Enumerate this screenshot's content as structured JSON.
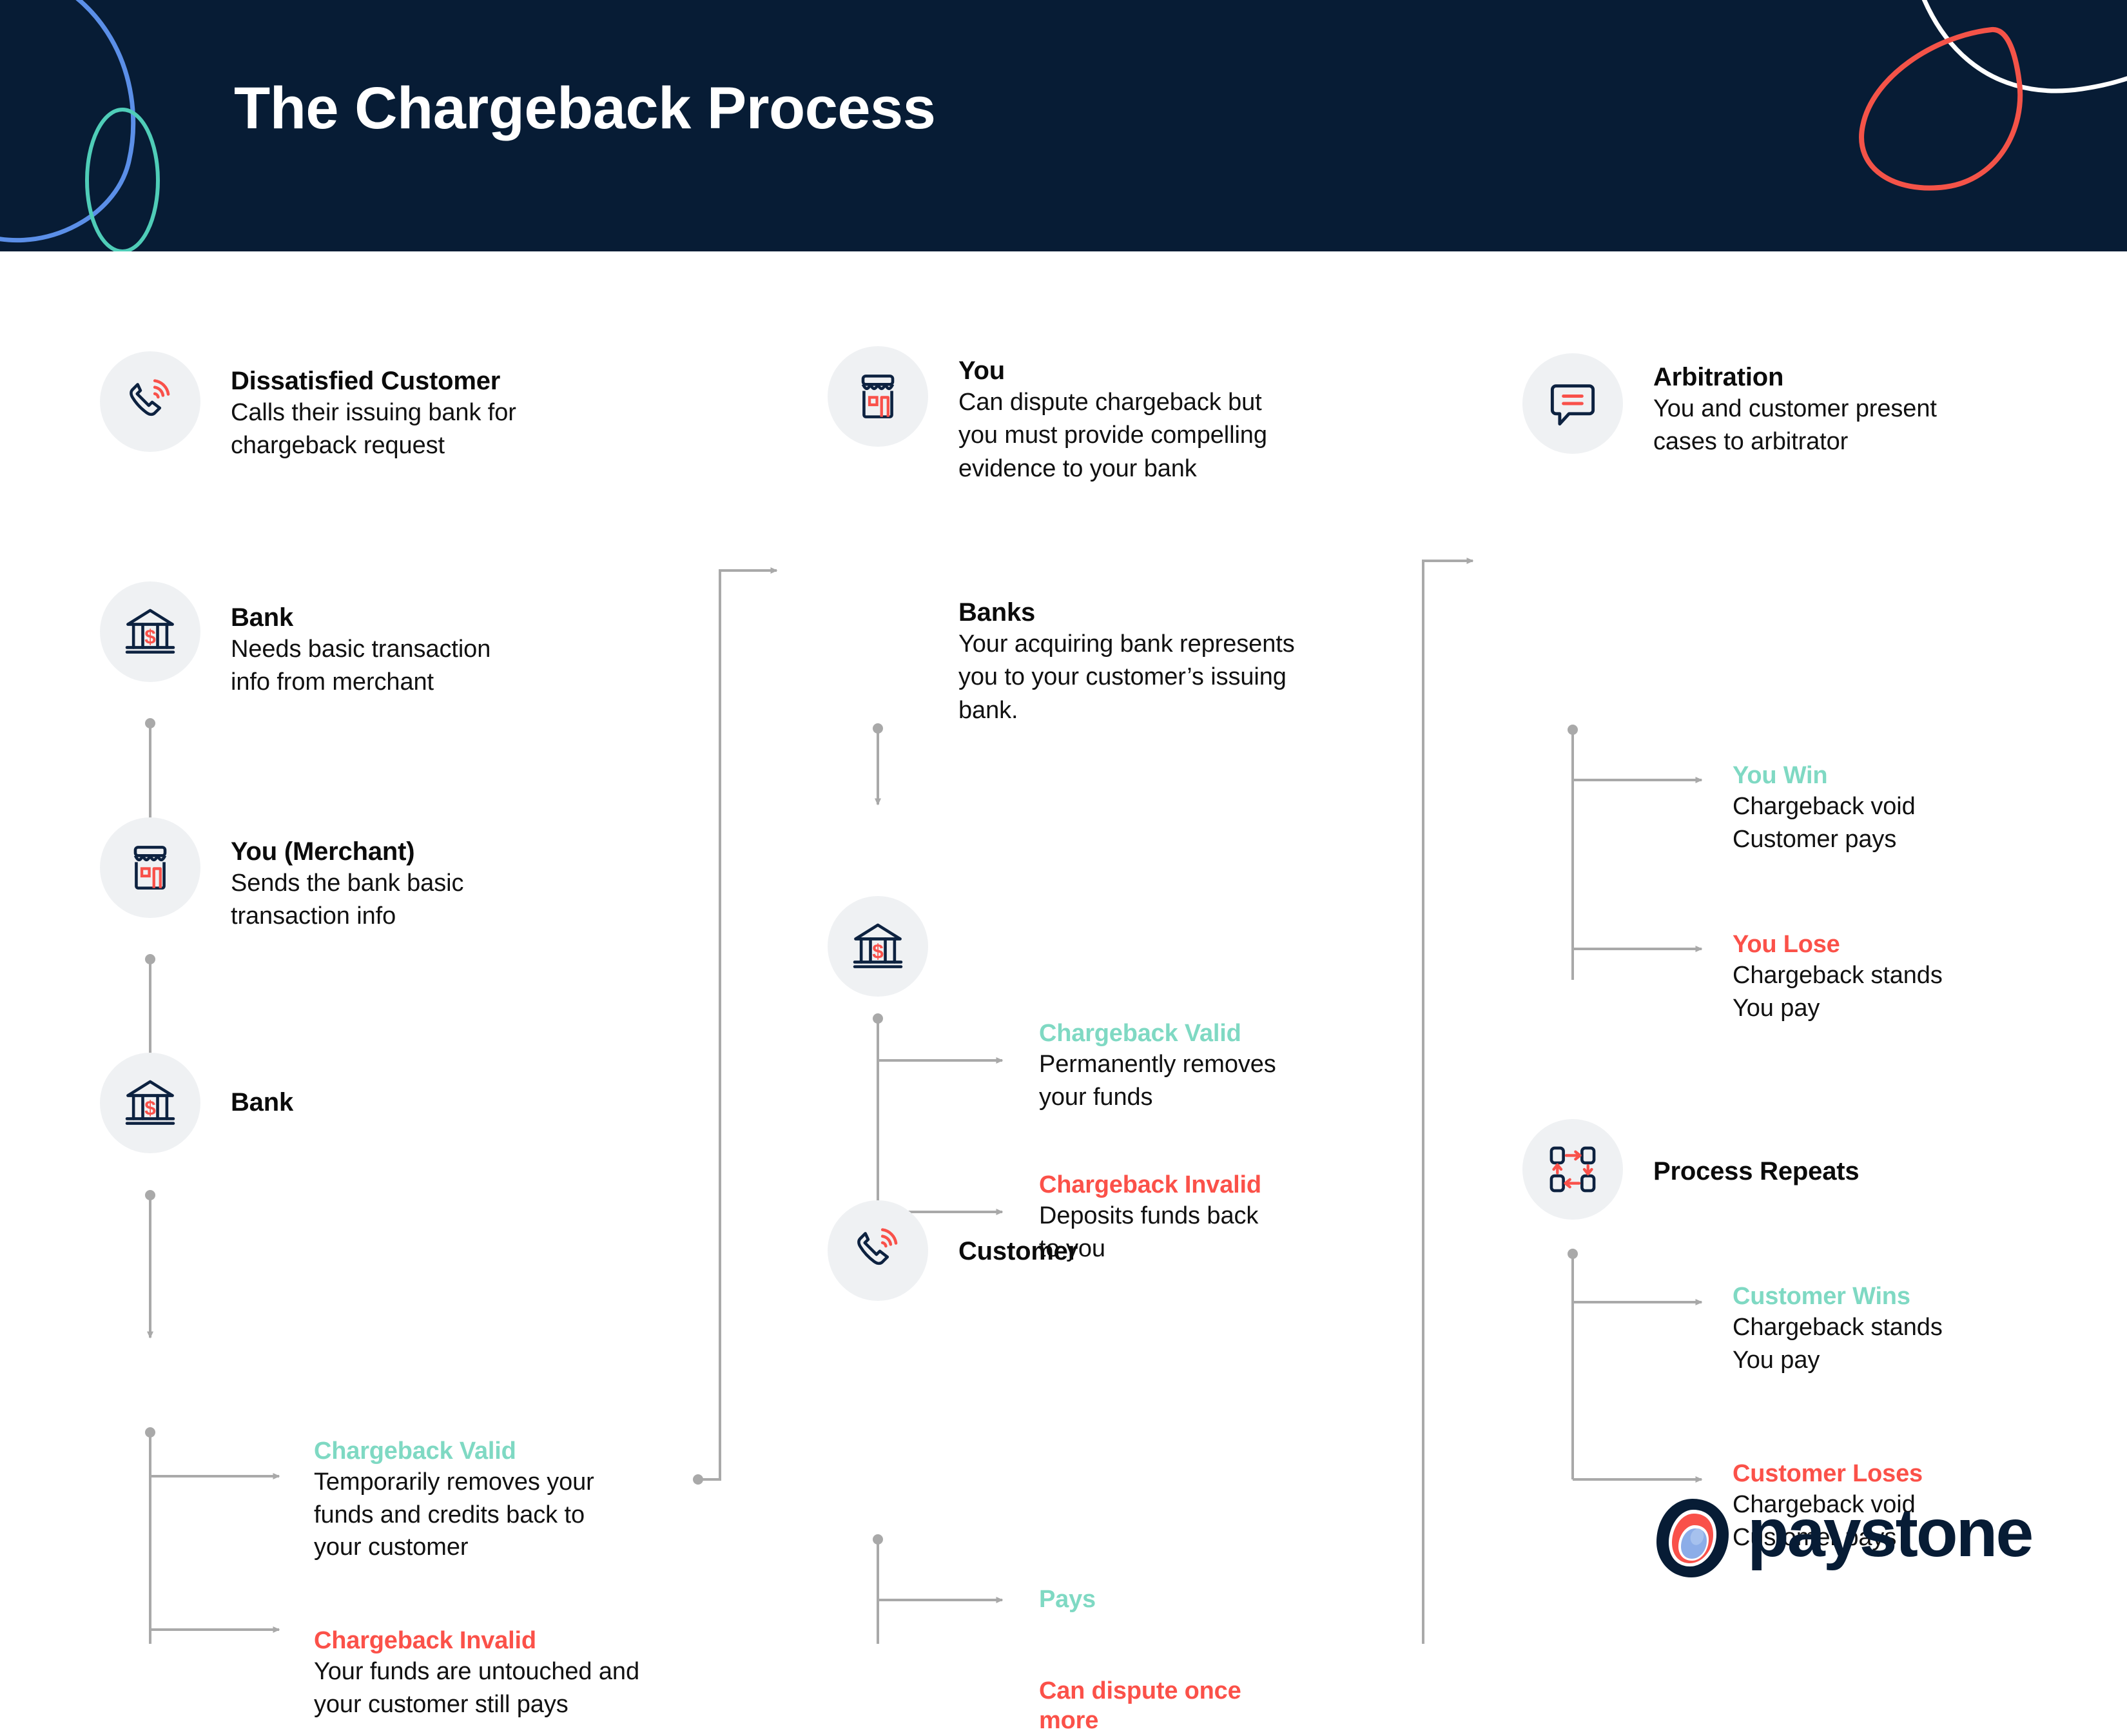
{
  "header": {
    "title": "The Chargeback Process",
    "bg_color": "#071C35",
    "decor": [
      {
        "name": "blue-blob-outline",
        "color": "#5B8FE8"
      },
      {
        "name": "teal-ellipse-outline",
        "color": "#4FCDB8"
      },
      {
        "name": "white-curve",
        "color": "#FFFFFF"
      },
      {
        "name": "coral-loop",
        "color": "#F45348"
      }
    ]
  },
  "colors": {
    "navy": "#071C35",
    "teal": "#7FD9C3",
    "coral": "#FB5149",
    "body_text": "#111111",
    "icon_bg": "#EFF1F3",
    "wire": "#A9A9A9"
  },
  "columns": [
    {
      "name": "column-1",
      "nodes": [
        {
          "icon": "phone-ringing-icon",
          "title": "Dissatisfied Customer",
          "desc": "Calls their issuing bank for\nchargeback request"
        },
        {
          "icon": "bank-dollar-icon",
          "title": "Bank",
          "desc": "Needs basic transaction\ninfo from merchant"
        },
        {
          "icon": "storefront-icon",
          "title": "You (Merchant)",
          "desc": "Sends the bank basic\ntransaction info"
        },
        {
          "icon": "bank-dollar-icon",
          "title": "Bank",
          "desc": ""
        }
      ],
      "outcomes": [
        {
          "kind": "valid",
          "title": "Chargeback Valid",
          "desc": "Temporarily removes your\nfunds and credits back to\nyour customer"
        },
        {
          "kind": "invalid",
          "title": "Chargeback Invalid",
          "desc": "Your funds are untouched and\nyour customer still pays"
        }
      ]
    },
    {
      "name": "column-2",
      "nodes": [
        {
          "icon": "storefront-icon",
          "title": "You",
          "desc": "Can dispute chargeback but\nyou must provide compelling\nevidence to your bank"
        },
        {
          "icon": "bank-dollar-icon",
          "title": "Banks",
          "desc": "Your acquiring bank represents\nyou to your customer’s issuing\nbank."
        },
        {
          "icon": "phone-ringing-icon",
          "title": "Customer",
          "desc": ""
        }
      ],
      "outcomes": [
        {
          "kind": "valid",
          "title": "Chargeback Valid",
          "desc": "Permanently removes\nyour funds"
        },
        {
          "kind": "invalid",
          "title": "Chargeback Invalid",
          "desc": "Deposits funds back\nto you"
        },
        {
          "kind": "valid",
          "title": "Pays",
          "desc": ""
        },
        {
          "kind": "invalid",
          "title": "Can dispute once\nmore",
          "desc": ""
        }
      ]
    },
    {
      "name": "column-3",
      "nodes": [
        {
          "icon": "speech-bubble-icon",
          "title": "Arbitration",
          "desc": "You and customer present\ncases to arbitrator"
        },
        {
          "icon": "process-repeat-icon",
          "title": "Process Repeats",
          "desc": ""
        }
      ],
      "outcomes": [
        {
          "kind": "valid",
          "title": "You Win",
          "desc": "Chargeback void\nCustomer pays"
        },
        {
          "kind": "invalid",
          "title": "You Lose",
          "desc": "Chargeback stands\nYou pay"
        },
        {
          "kind": "valid",
          "title": "Customer Wins",
          "desc": "Chargeback stands\nYou pay"
        },
        {
          "kind": "invalid",
          "title": "Customer Loses",
          "desc": "Chargeback void\nCustomer pays"
        }
      ]
    }
  ],
  "logo": {
    "name": "paystone-logo",
    "wordmark": "paystone",
    "mark_outer_color": "#071C35",
    "mark_mid_color": "#F9514A",
    "mark_inner_color": "#8CADE8"
  }
}
